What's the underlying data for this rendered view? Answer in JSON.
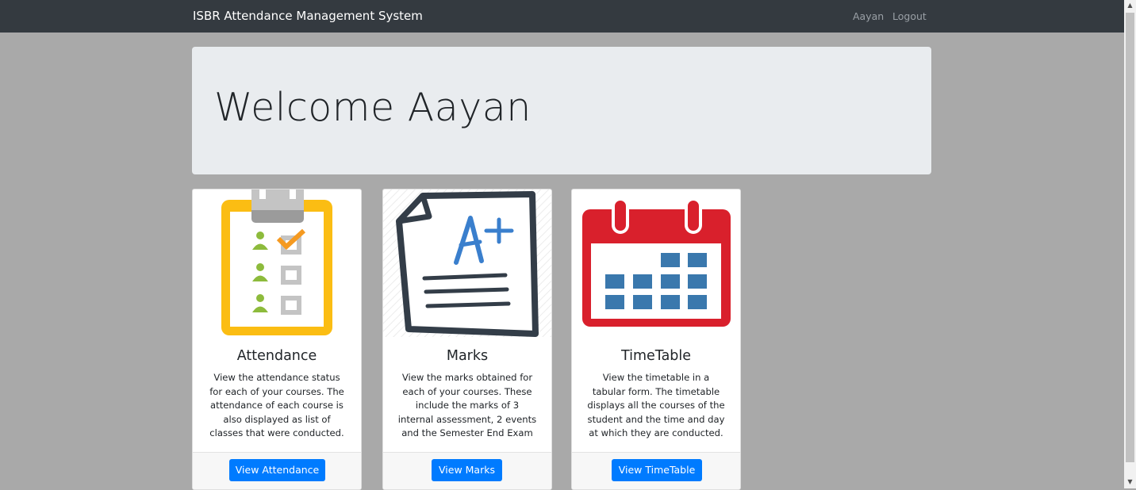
{
  "navbar": {
    "brand": "ISBR Attendance Management System",
    "user": "Aayan",
    "logout": "Logout"
  },
  "jumbotron": {
    "welcome": "Welcome Aayan"
  },
  "cards": [
    {
      "title": "Attendance",
      "text": "View the attendance status for each of your courses. The attendance of each course is also displayed as list of classes that were conducted.",
      "button": "View Attendance",
      "icon": "attendance-checklist-icon"
    },
    {
      "title": "Marks",
      "text": "View the marks obtained for each of your courses. These include the marks of 3 internal assessment, 2 events and the Semester End Exam",
      "button": "View Marks",
      "icon": "marks-grade-icon"
    },
    {
      "title": "TimeTable",
      "text": "View the timetable in a tabular form. The timetable displays all the courses of the student and the time and day at which they are conducted.",
      "button": "View TimeTable",
      "icon": "calendar-icon"
    }
  ],
  "colors": {
    "navbar": "#343a40",
    "background": "#a9a9a9",
    "jumbotron": "#e9ecef",
    "primary_button": "#007bff"
  }
}
